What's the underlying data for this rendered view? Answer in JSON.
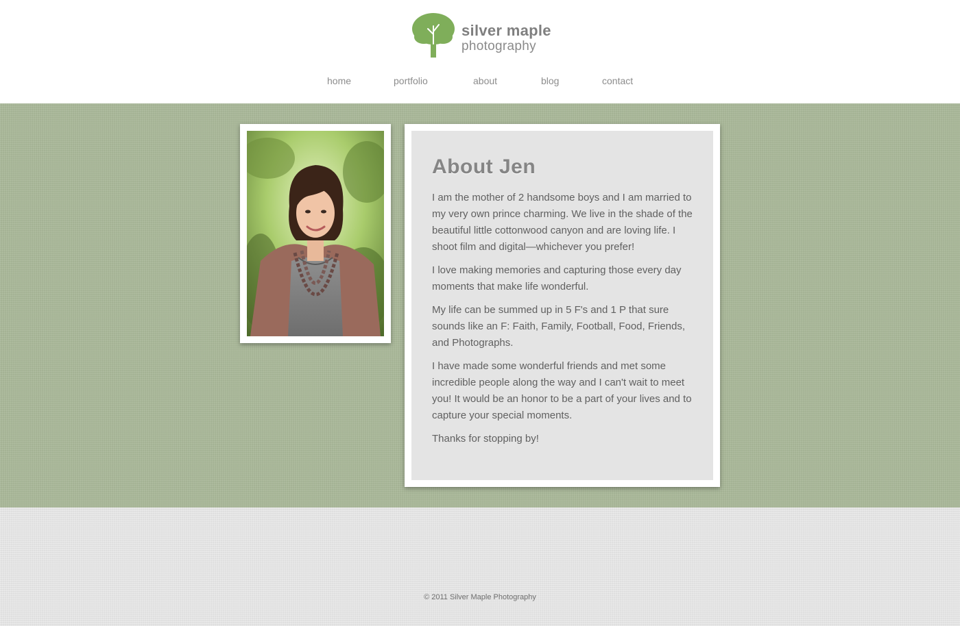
{
  "brand": {
    "name_line1": "silver maple",
    "name_line2": "photography",
    "logo_color": "#7fae5a",
    "logo_icon": "tree-icon"
  },
  "nav": {
    "items": [
      {
        "label": "home"
      },
      {
        "label": "portfolio"
      },
      {
        "label": "about"
      },
      {
        "label": "blog"
      },
      {
        "label": "contact"
      }
    ]
  },
  "about": {
    "title": "About Jen",
    "photo_alt": "Portrait of Jen",
    "paragraphs": [
      "I am the mother of 2 handsome boys and I am married to my very own prince charming. We live in the shade of the beautiful little cottonwood canyon and are loving life. I shoot film and digital—whichever you prefer!",
      "I love making memories and capturing those every day moments that make life wonderful.",
      "My life can be summed up in 5 F's and 1 P that sure sounds like an F: Faith, Family, Football, Food, Friends, and Photographs.",
      "I have made some wonderful friends and met some incredible people along the way and I can't wait to meet you! It would be an honor to be a part of your lives and to capture your special moments.",
      "Thanks for stopping by!"
    ]
  },
  "footer": {
    "copyright": "© 2011 Silver Maple Photography"
  },
  "colors": {
    "main_background": "#a8b797",
    "footer_background": "#e0e0e0",
    "card_background": "#e4e4e4",
    "text": "#606060"
  }
}
